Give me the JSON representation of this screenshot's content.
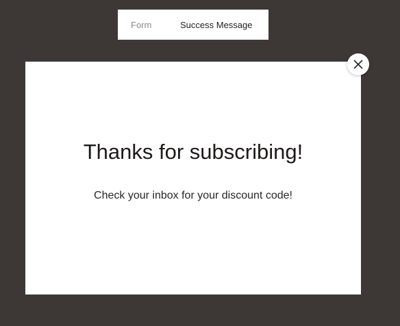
{
  "tabs": {
    "form_label": "Form",
    "success_label": "Success Message"
  },
  "modal": {
    "title": "Thanks for subscribing!",
    "message": "Check your inbox for your discount code!",
    "close_icon": "close-icon"
  },
  "colors": {
    "backdrop": "#3d3736",
    "panel": "#ffffff",
    "inactive_tab_text": "#8a8a8a",
    "active_tab_text": "#222222"
  }
}
